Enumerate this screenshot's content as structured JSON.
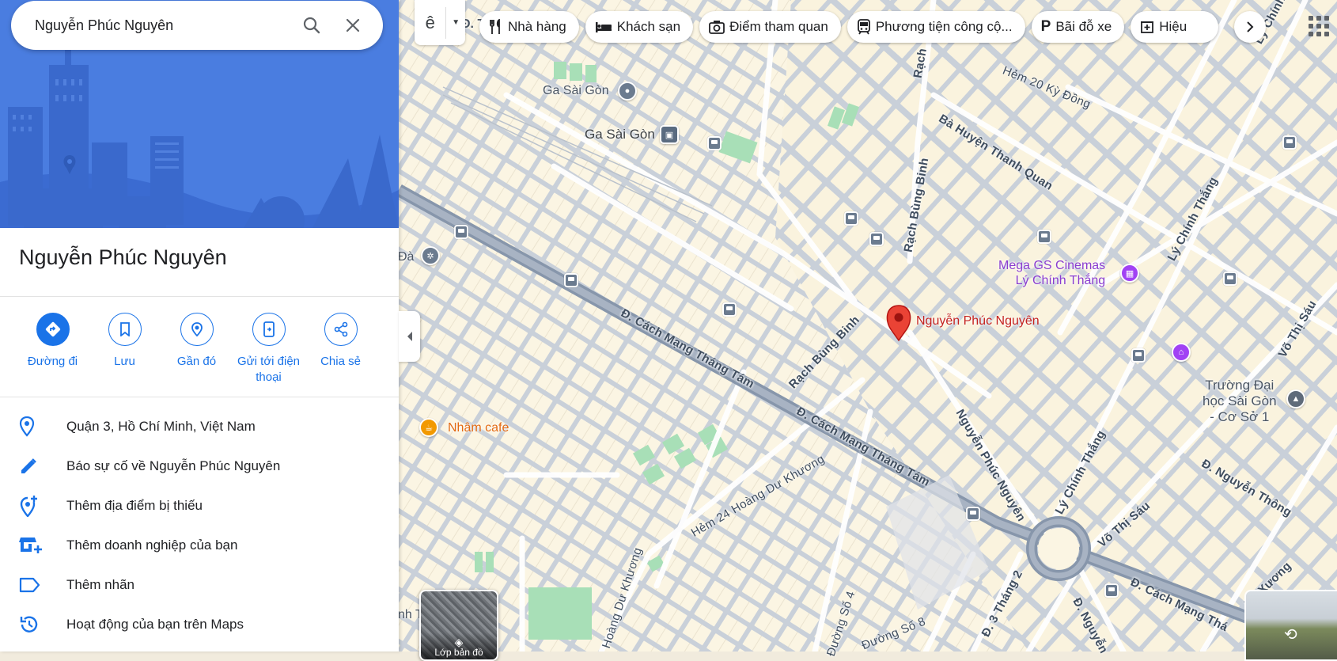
{
  "search": {
    "query": "Nguyễn Phúc Nguyên"
  },
  "place": {
    "title": "Nguyễn Phúc Nguyên"
  },
  "actions": [
    {
      "label": "Đường đi",
      "icon": "directions-icon"
    },
    {
      "label": "Lưu",
      "icon": "bookmark-icon"
    },
    {
      "label": "Gần đó",
      "icon": "nearby-icon"
    },
    {
      "label": "Gửi tới điện thoại",
      "icon": "send-to-phone-icon"
    },
    {
      "label": "Chia sẻ",
      "icon": "share-icon"
    }
  ],
  "info_rows": [
    {
      "text": "Quận 3, Hồ Chí Minh, Việt Nam",
      "icon": "location-pin-icon"
    },
    {
      "text": "Báo sự cố về Nguyễn Phúc Nguyên",
      "icon": "pencil-icon"
    },
    {
      "text": "Thêm địa điểm bị thiếu",
      "icon": "add-location-icon"
    },
    {
      "text": "Thêm doanh nghiệp của bạn",
      "icon": "add-business-icon"
    },
    {
      "text": "Thêm nhãn",
      "icon": "label-icon"
    },
    {
      "text": "Hoạt động của bạn trên Maps",
      "icon": "history-icon"
    }
  ],
  "chips": [
    {
      "label": "Nhà hàng",
      "icon": "restaurant-icon"
    },
    {
      "label": "Khách sạn",
      "icon": "hotel-icon"
    },
    {
      "label": "Điểm tham quan",
      "icon": "camera-icon"
    },
    {
      "label": "Phương tiện công cộ...",
      "icon": "transit-icon"
    },
    {
      "label": "Bãi đỗ xe",
      "icon": "parking-icon"
    },
    {
      "label": "Hiệu",
      "icon": "pharmacy-icon"
    }
  ],
  "layers_toggle_glyph": "ê",
  "layer_thumb_label": "Lớp bản đồ",
  "map": {
    "places": {
      "ga_saigon_1": "Ga Sài Gòn",
      "ga_saigon_2": "Ga Sài Gòn",
      "mega_gs": "Mega GS Cinemas\nLý Chính Thắng",
      "marker": "Nguyễn Phúc Nguyên",
      "nham_cafe": "Nhâm cafe",
      "truong_dh": "Trường Đại\nhọc Sài Gòn\n- Cơ Sở 1",
      "da": "Đà",
      "nh_t": "nh T",
      "d_t": "Đ. T"
    },
    "roads": {
      "cmtt1": "Đ. Cách Mạng Tháng Tám",
      "cmtt2": "Đ. Cách Mạng Tháng Tám",
      "cmtt3": "Đ. Cách Mạng Thá",
      "rach_bung_binh1": "Rạch Bùng Binh",
      "rach_bung_binh2": "Rạch Bùng Binh",
      "rach": "Rạch",
      "hem20": "Hẻm 20 Kỳ Đồng",
      "ba_huyen": "Bà Huyện Thanh Quan",
      "ly_chinh_thang1": "Lý Chính Thắng",
      "ly_chinh_thang2": "Lý Chính Thắng",
      "ly_chinh_thang3": "Lý Chính Thắng",
      "vo_thi_sau1": "Võ Thị Sáu",
      "vo_thi_sau2": "Võ Thị Sáu",
      "nguyen_phuc_nguyen": "Nguyễn Phúc Nguyên",
      "hem24": "Hẻm 24 Hoàng Dư Khương",
      "hoang_du_khuong1": "Hoàng Dư Khương",
      "hoang_du_khuong2": "Hoàng Dư Khương",
      "d3thang2": "Đ. 3 Tháng 2",
      "duong_so_8": "Đường Số 8",
      "duong_so_4": "Đường Số 4",
      "nguyen_thong": "Đ. Nguyễn Thông",
      "tu_xuong": "Tú Xương",
      "d_nguyen": "Đ. Nguyễn"
    },
    "colors": {
      "land": "#f1ebdd",
      "block": "#fbf5e3",
      "road": "#c9d0d9",
      "major_road": "#8796ab",
      "park": "#a8dfb7",
      "accent": "#1a73e8",
      "marker": "#ea4335"
    }
  }
}
